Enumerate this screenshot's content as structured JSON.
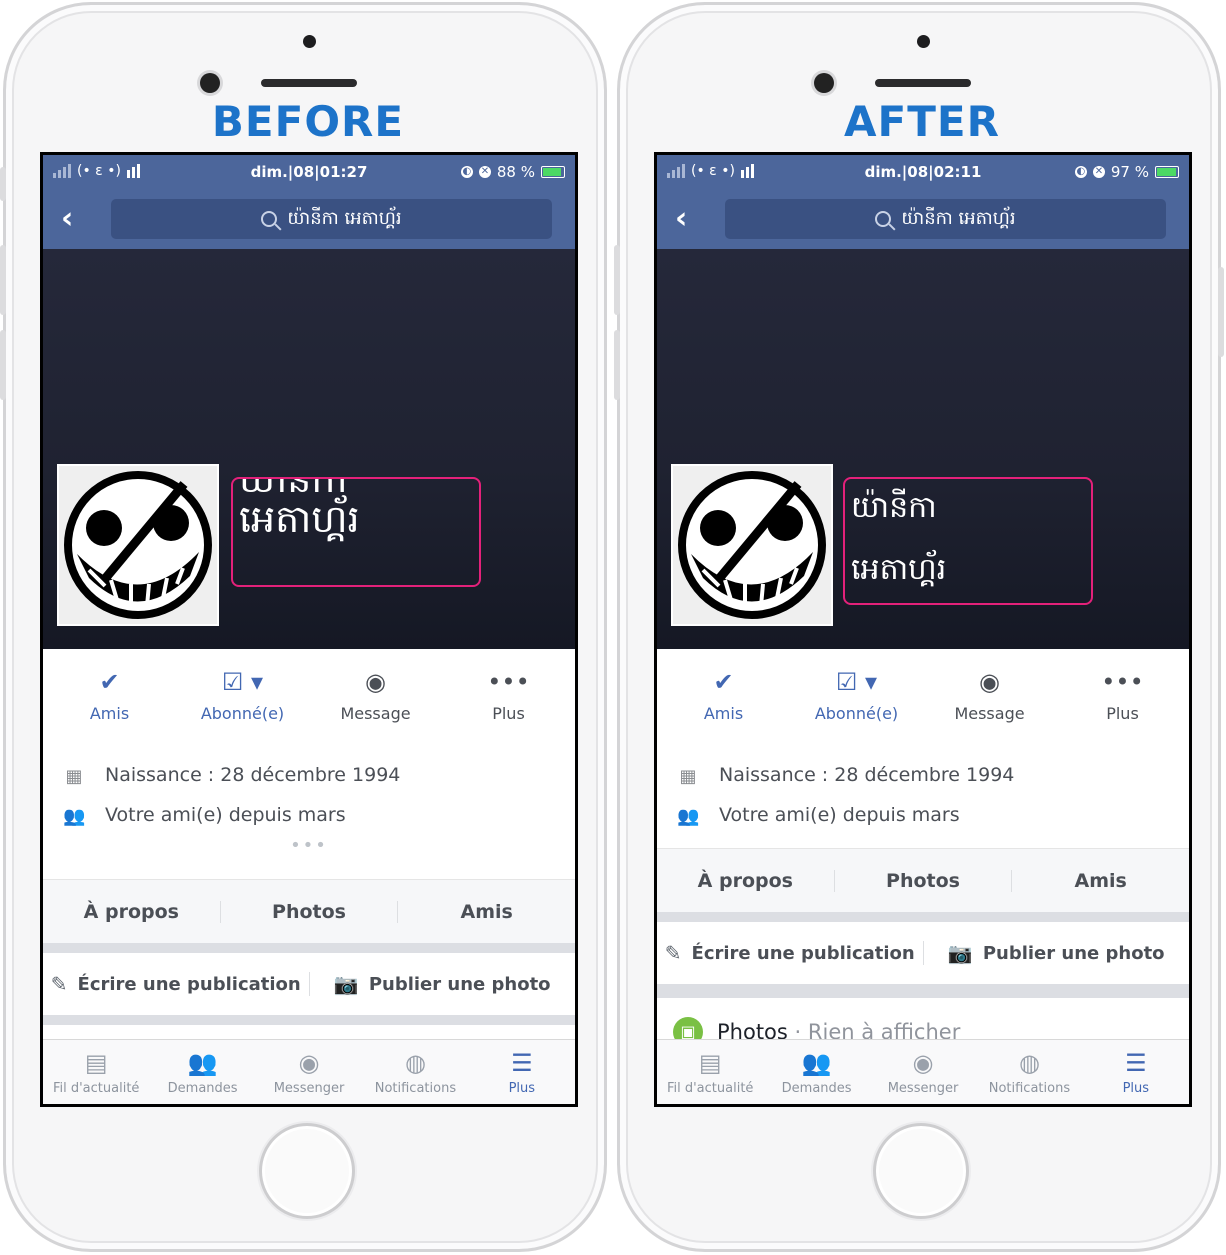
{
  "labels": {
    "before": "BEFORE",
    "after": "AFTER"
  },
  "before": {
    "status": {
      "carrier_glyph": "(• ε •)",
      "time": "dim.|08|01:27",
      "battery": "88 %"
    },
    "search_text": "យ៉ានីកា អេតាហ្គ័រ",
    "profile_name_line1": "យ៉ានីកា",
    "profile_name_line2": "អេតាហ្គ័រ",
    "actions": [
      "Amis",
      "Abonné(e)",
      "Message",
      "Plus"
    ],
    "info": {
      "birthday": "Naissance : 28 décembre 1994",
      "friends_since": "Votre ami(e) depuis mars",
      "more": "•••"
    },
    "tabs": [
      "À propos",
      "Photos",
      "Amis"
    ],
    "composer": {
      "write": "Écrire une publication",
      "photo": "Publier une photo"
    }
  },
  "after": {
    "status": {
      "carrier_glyph": "(• ε •)",
      "time": "dim.|08|02:11",
      "battery": "97 %"
    },
    "search_text": "យ៉ានីកា អេតាហ្គ័រ",
    "profile_name_line1": "យ៉ានីកា",
    "profile_name_line2": "អេតាហ្គ័រ",
    "actions": [
      "Amis",
      "Abonné(e)",
      "Message",
      "Plus"
    ],
    "info": {
      "birthday": "Naissance : 28 décembre 1994",
      "friends_since": "Votre ami(e) depuis mars"
    },
    "tabs": [
      "À propos",
      "Photos",
      "Amis"
    ],
    "composer": {
      "write": "Écrire une publication",
      "photo": "Publier une photo"
    },
    "photos_row": {
      "title": "Photos",
      "sep": " · ",
      "status": "Rien à afficher"
    }
  },
  "tabbar": [
    "Fil d'actualité",
    "Demandes",
    "Messenger",
    "Notifications",
    "Plus"
  ],
  "icons": {
    "back": "chevron-left-icon",
    "search": "search-icon",
    "amis": "friend-check-icon",
    "abonne": "subscribed-icon",
    "message": "messenger-icon",
    "plus": "more-dots-icon",
    "birthday": "calendar-icon",
    "friends": "people-icon",
    "write": "pencil-square-icon",
    "photo": "camera-icon",
    "news": "newsfeed-icon",
    "requests": "friend-requests-icon",
    "messenger": "messenger-icon",
    "notifications": "globe-icon",
    "menu": "hamburger-icon"
  },
  "colors": {
    "facebook_blue": "#4c669b",
    "link_blue": "#4267b2",
    "highlight_box": "#e3217a",
    "label_blue": "#1d73c9"
  }
}
